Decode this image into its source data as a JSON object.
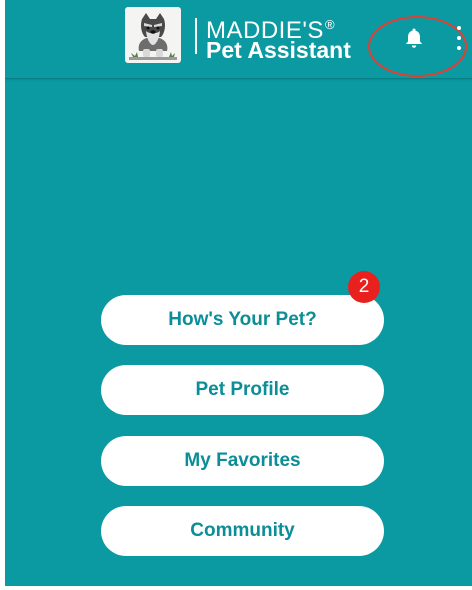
{
  "app_bar": {
    "brand_top": "MADDIE'S",
    "brand_registered": "®",
    "brand_bottom": "Pet Assistant",
    "logo_icon": "schnauzer-dog-logo-icon",
    "notifications_icon": "bell-icon",
    "overflow_icon": "more-vertical-icon"
  },
  "menu": {
    "items": [
      {
        "label": "How's Your Pet?",
        "badge": "2"
      },
      {
        "label": "Pet Profile"
      },
      {
        "label": "My Favorites"
      },
      {
        "label": "Community"
      }
    ]
  },
  "colors": {
    "background": "#0b9aa2",
    "button_bg": "#ffffff",
    "button_text": "#0b8e97",
    "badge": "#e8211e",
    "highlight_circle": "#e53d2f"
  }
}
